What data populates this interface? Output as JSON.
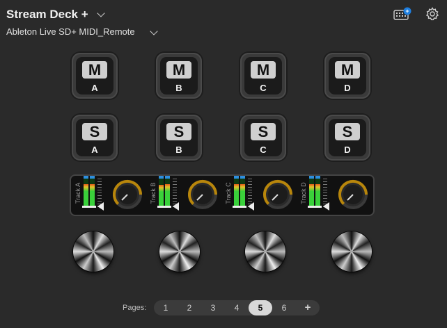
{
  "header": {
    "title": "Stream Deck +",
    "profile": "Ableton Live SD+ MIDI_Remote",
    "badge_plus": "+"
  },
  "keys": {
    "mute": [
      {
        "badge": "M",
        "label": "A"
      },
      {
        "badge": "M",
        "label": "B"
      },
      {
        "badge": "M",
        "label": "C"
      },
      {
        "badge": "M",
        "label": "D"
      }
    ],
    "solo": [
      {
        "badge": "S",
        "label": "A"
      },
      {
        "badge": "S",
        "label": "B"
      },
      {
        "badge": "S",
        "label": "C"
      },
      {
        "badge": "S",
        "label": "D"
      }
    ]
  },
  "touch_strip": {
    "tracks": [
      {
        "name": "Track A",
        "meter_left": 0.82,
        "meter_right": 0.8,
        "knob_level": 0.7
      },
      {
        "name": "Track B",
        "meter_left": 0.78,
        "meter_right": 0.82,
        "knob_level": 0.7
      },
      {
        "name": "Track C",
        "meter_left": 0.8,
        "meter_right": 0.8,
        "knob_level": 0.7
      },
      {
        "name": "Track D",
        "meter_left": 0.8,
        "meter_right": 0.82,
        "knob_level": 0.7
      }
    ]
  },
  "pager": {
    "label": "Pages:",
    "pages": [
      "1",
      "2",
      "3",
      "4",
      "5",
      "6"
    ],
    "active": "5",
    "add": "+"
  },
  "colors": {
    "accent_blue": "#1e7fe0",
    "ring_gold": "#b8860b",
    "meter_green": "#39d23b"
  },
  "icons": [
    "chevron-down-icon",
    "device-keyboard-icon",
    "gear-icon"
  ]
}
